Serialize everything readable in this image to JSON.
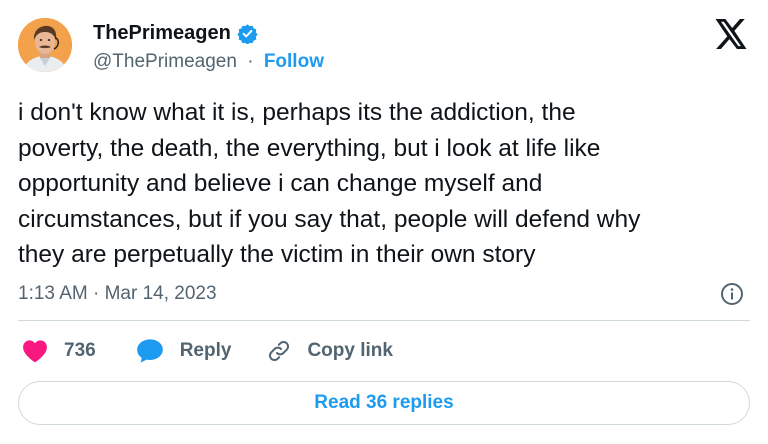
{
  "author": {
    "display_name": "ThePrimeagen",
    "handle": "@ThePrimeagen",
    "separator": "·",
    "follow_label": "Follow",
    "verified": true
  },
  "icons": {
    "avatar": "profile-photo",
    "verified": "verified-badge-icon",
    "platform": "x-logo-icon",
    "info": "info-icon",
    "like": "heart-icon",
    "reply": "speech-bubble-icon",
    "copy": "link-icon"
  },
  "tweet": {
    "text": "i don't know what it is, perhaps its the addiction, the\npoverty, the death, the everything, but i look at life like\nopportunity and believe i can change myself and\ncircumstances, but if you say that, people will defend why\nthey are perpetually the victim in their own story",
    "timestamp": "1:13 AM · Mar 14, 2023"
  },
  "actions": {
    "like_count": "736",
    "reply_label": "Reply",
    "copy_link_label": "Copy link"
  },
  "footer": {
    "read_replies_label": "Read 36 replies"
  },
  "colors": {
    "accent": "#1d9bf0",
    "like": "#f91880",
    "reply_icon": "#1d9bf0",
    "text_primary": "#0f1419",
    "text_secondary": "#536471",
    "border": "#cfd9de"
  }
}
